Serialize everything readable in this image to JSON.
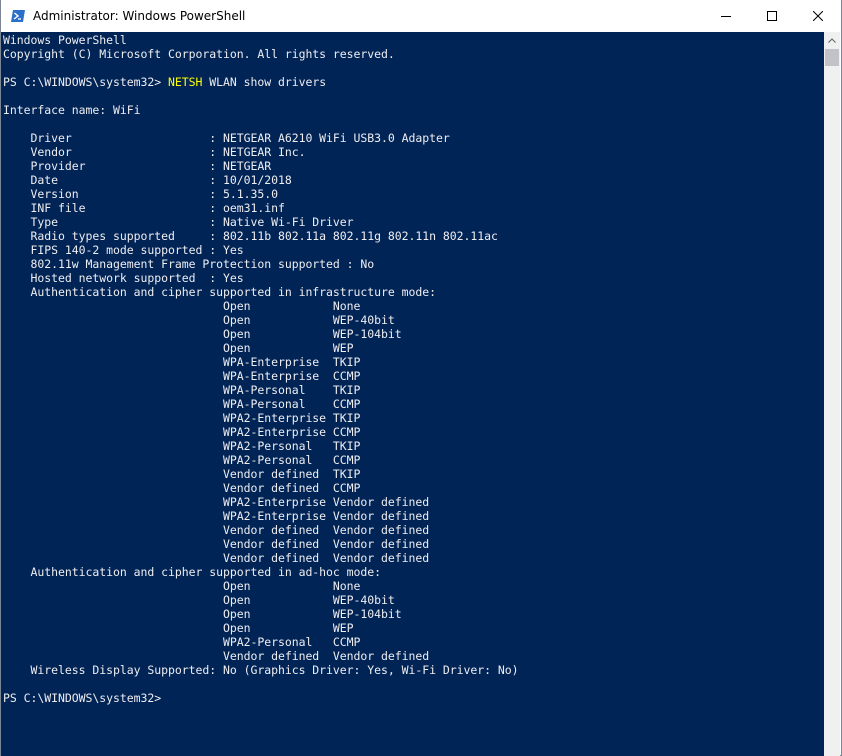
{
  "window": {
    "title": "Administrator: Windows PowerShell"
  },
  "console": {
    "banner_line1": "Windows PowerShell",
    "banner_line2": "Copyright (C) Microsoft Corporation. All rights reserved.",
    "prompt1": "PS C:\\WINDOWS\\system32> ",
    "command": "NETSH",
    "command_args": " WLAN show drivers",
    "interface_line": "Interface name: WiFi",
    "driver_lines": [
      "    Driver                    : NETGEAR A6210 WiFi USB3.0 Adapter",
      "    Vendor                    : NETGEAR Inc.",
      "    Provider                  : NETGEAR",
      "    Date                      : 10/01/2018",
      "    Version                   : 5.1.35.0",
      "    INF file                  : oem31.inf",
      "    Type                      : Native Wi-Fi Driver",
      "    Radio types supported     : 802.11b 802.11a 802.11g 802.11n 802.11ac",
      "    FIPS 140-2 mode supported : Yes",
      "    802.11w Management Frame Protection supported : No",
      "    Hosted network supported  : Yes",
      "    Authentication and cipher supported in infrastructure mode:",
      "                                Open            None",
      "                                Open            WEP-40bit",
      "                                Open            WEP-104bit",
      "                                Open            WEP",
      "                                WPA-Enterprise  TKIP",
      "                                WPA-Enterprise  CCMP",
      "                                WPA-Personal    TKIP",
      "                                WPA-Personal    CCMP",
      "                                WPA2-Enterprise TKIP",
      "                                WPA2-Enterprise CCMP",
      "                                WPA2-Personal   TKIP",
      "                                WPA2-Personal   CCMP",
      "                                Vendor defined  TKIP",
      "                                Vendor defined  CCMP",
      "                                WPA2-Enterprise Vendor defined",
      "                                WPA2-Enterprise Vendor defined",
      "                                Vendor defined  Vendor defined",
      "                                Vendor defined  Vendor defined",
      "                                Vendor defined  Vendor defined",
      "    Authentication and cipher supported in ad-hoc mode:",
      "                                Open            None",
      "                                Open            WEP-40bit",
      "                                Open            WEP-104bit",
      "                                Open            WEP",
      "                                WPA2-Personal   CCMP",
      "                                Vendor defined  Vendor defined",
      "    Wireless Display Supported: No (Graphics Driver: Yes, Wi-Fi Driver: No)"
    ],
    "prompt2": "PS C:\\WINDOWS\\system32>"
  },
  "colors": {
    "console_bg": "#012456",
    "console_fg": "#eeedf0",
    "command_highlight": "#ffff00"
  },
  "icons": {
    "app": "powershell-icon",
    "minimize": "minimize-icon",
    "maximize": "maximize-icon",
    "close": "close-icon",
    "scroll_up": "scroll-up-arrow-icon"
  }
}
